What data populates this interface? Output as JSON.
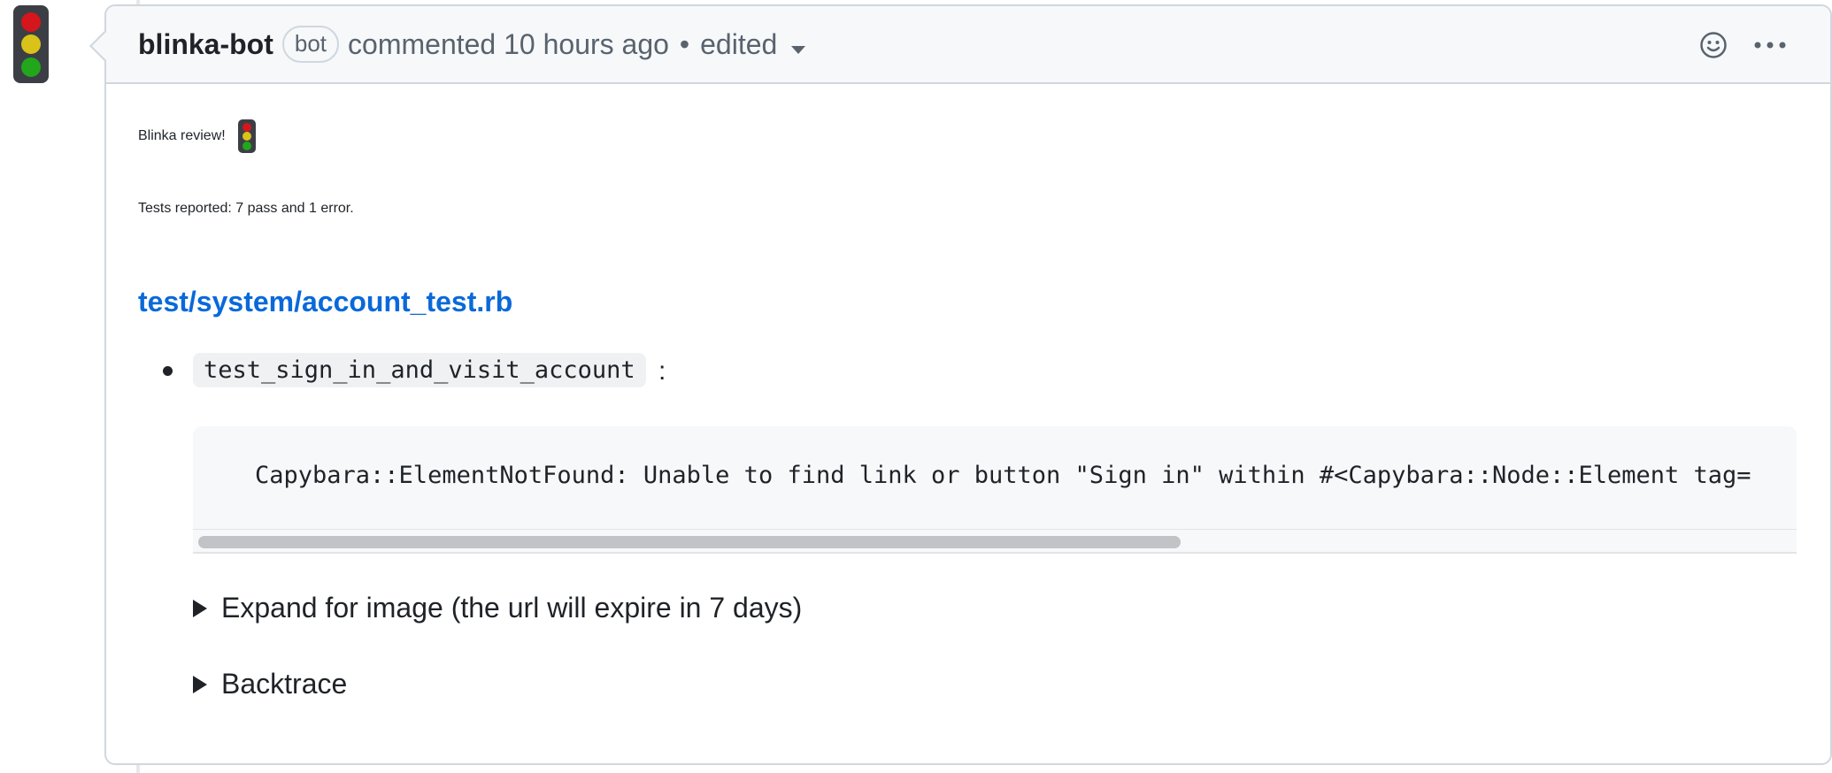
{
  "comment": {
    "author": "blinka-bot",
    "badge": "bot",
    "action": "commented 10 hours ago",
    "separator": "•",
    "edited": "edited",
    "avatar_colors": [
      "#d5161c",
      "#d9c21a",
      "#22a61b"
    ],
    "header_icons": [
      "smiley-icon",
      "kebab-menu-icon"
    ]
  },
  "body": {
    "greeting": "Blinka review!",
    "greeting_emoji": "traffic-light-icon",
    "summary": "Tests reported: 7 pass and 1 error.",
    "file_link": "test/system/account_test.rb",
    "test_name": "test_sign_in_and_visit_account",
    "colon": ":",
    "error_message": "Capybara::ElementNotFound: Unable to find link or button \"Sign in\" within #<Capybara::Node::Element tag=",
    "details": [
      {
        "label": "Expand for image (the url will expire in 7 days)"
      },
      {
        "label": "Backtrace"
      }
    ]
  },
  "colors": {
    "link": "#0969da",
    "border": "#d0d7de",
    "header_bg": "#f6f8fa"
  }
}
